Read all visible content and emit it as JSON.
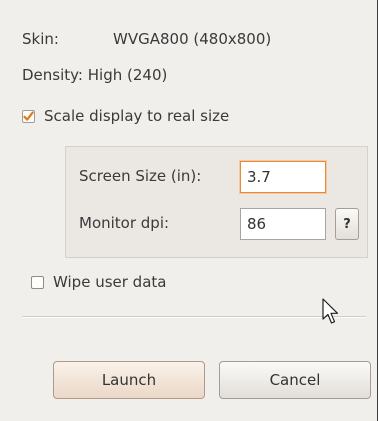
{
  "skin": {
    "label": "Skin:",
    "value": "WVGA800 (480x800)"
  },
  "density": {
    "text": "Density: High (240)"
  },
  "scale": {
    "label": "Scale display to real size",
    "checked": true
  },
  "screen_size": {
    "label": "Screen Size (in):",
    "value": "3.7"
  },
  "monitor_dpi": {
    "label": "Monitor dpi:",
    "value": "86",
    "help_label": "?"
  },
  "wipe": {
    "label": "Wipe user data",
    "checked": false
  },
  "buttons": {
    "launch": "Launch",
    "cancel": "Cancel"
  },
  "colors": {
    "focus_accent": "#e68a3c",
    "check_mark": "#e07a1f",
    "dialog_bg": "#f1efec"
  },
  "icons": {
    "check": "check-icon",
    "cursor": "mouse-pointer-icon"
  }
}
